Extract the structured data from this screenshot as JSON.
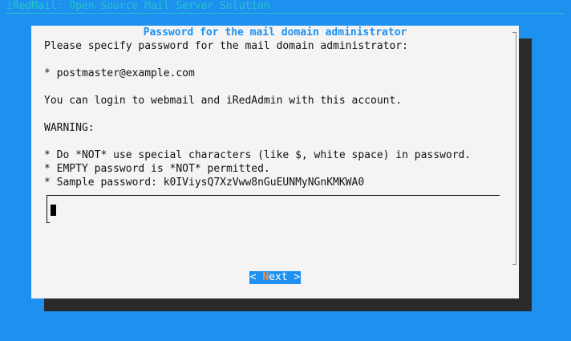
{
  "backtitle": "iRedMail: Open Source Mail Server Solution",
  "dialog": {
    "title": "Password for the mail domain administrator",
    "lines": [
      "Please specify password for the mail domain administrator:",
      "* postmaster@example.com",
      "You can login to webmail and iRedAdmin with this account.",
      "WARNING:",
      "* Do *NOT* use special characters (like $, white space) in password.",
      "* EMPTY password is *NOT* permitted.",
      "* Sample password: k0IViysQ7XzVww8nGuEUNMyNGnKMKWA0"
    ],
    "password_value": ""
  },
  "buttons": {
    "next": {
      "open": "< ",
      "hotkey": "N",
      "rest": "ext",
      "close": " >"
    }
  },
  "colors": {
    "background": "#1e90f0",
    "dialog": "#f4f4f4",
    "shadow": "#2a2a2a",
    "title": "#1e90f0",
    "backtitle": "#22c6c6",
    "hotkey": "#ff8c2a"
  }
}
